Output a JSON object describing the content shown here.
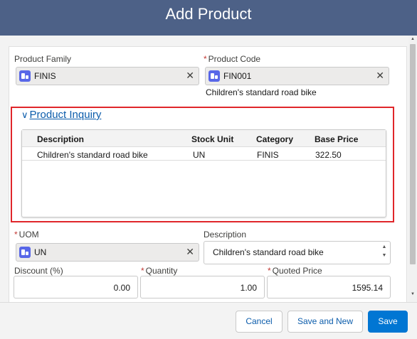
{
  "modal": {
    "title": "Add Product"
  },
  "fields": {
    "product_family": {
      "label": "Product Family",
      "value": "FINIS"
    },
    "product_code": {
      "label": "Product Code",
      "required_mark": "*",
      "value": "FIN001",
      "helper": "Children's standard road bike"
    },
    "uom": {
      "label": "UOM",
      "required_mark": "*",
      "value": "UN"
    },
    "description": {
      "label": "Description",
      "value": "Children's standard road bike"
    },
    "discount": {
      "label": "Discount (%)",
      "value": "0.00"
    },
    "quantity": {
      "label": "Quantity",
      "required_mark": "*",
      "value": "1.00"
    },
    "quoted_price": {
      "label": "Quoted Price",
      "required_mark": "*",
      "value": "1595.14"
    }
  },
  "inquiry": {
    "title": "Product Inquiry",
    "columns": [
      "Description",
      "Stock Unit",
      "Category",
      "Base Price"
    ],
    "rows": [
      [
        "Children's standard road bike",
        "UN",
        "FINIS",
        "322.50"
      ]
    ]
  },
  "icons": {
    "clear": "close-icon",
    "lookup": "product-object-icon",
    "collapse": "chevron-down-icon"
  },
  "colors": {
    "header": "#4d6187",
    "brand": "#0176d3",
    "highlight_border": "#e0262a",
    "link": "#0b5cab"
  },
  "footer": {
    "cancel": "Cancel",
    "save_and_new": "Save and New",
    "save": "Save"
  }
}
